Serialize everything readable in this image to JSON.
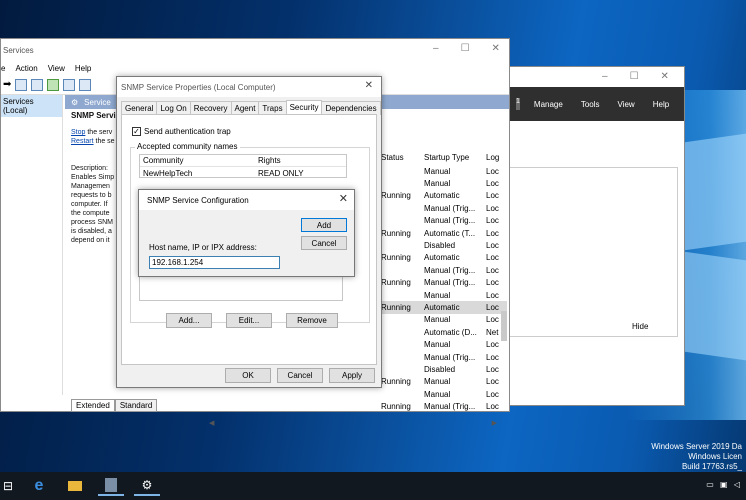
{
  "desktop": {
    "info_lines": [
      "Windows Server 2019 Da",
      "Windows Licen",
      "Build 17763.rs5_"
    ]
  },
  "services_window": {
    "title": "Services",
    "menu": [
      "e",
      "Action",
      "View",
      "Help"
    ],
    "tree_item": "Services (Local)",
    "list_header": "Service",
    "selected_service": "SNMP Servic",
    "stop_link": "Stop",
    "stop_rest": " the serv",
    "restart_link": "Restart",
    "restart_rest": " the se",
    "description_label": "Description:",
    "description_lines": [
      "Enables Simp",
      "Managemen",
      "requests to b",
      "computer. If",
      "the compute",
      "process SNM",
      "is disabled, a",
      "depend on it"
    ],
    "columns": {
      "status": "Status",
      "startup": "Startup Type",
      "log": "Log"
    },
    "rows": [
      {
        "status": "",
        "startup": "Manual",
        "log": "Loc"
      },
      {
        "status": "",
        "startup": "Manual",
        "log": "Loc"
      },
      {
        "status": "Running",
        "startup": "Automatic",
        "log": "Loc"
      },
      {
        "status": "",
        "startup": "Manual (Trig...",
        "log": "Loc"
      },
      {
        "status": "",
        "startup": "Manual (Trig...",
        "log": "Loc"
      },
      {
        "status": "Running",
        "startup": "Automatic (T...",
        "log": "Loc"
      },
      {
        "status": "",
        "startup": "Disabled",
        "log": "Loc"
      },
      {
        "status": "Running",
        "startup": "Automatic",
        "log": "Loc"
      },
      {
        "status": "",
        "startup": "Manual (Trig...",
        "log": "Loc"
      },
      {
        "status": "Running",
        "startup": "Manual (Trig...",
        "log": "Loc"
      },
      {
        "status": "",
        "startup": "Manual",
        "log": "Loc"
      },
      {
        "status": "Running",
        "startup": "Automatic",
        "log": "Loc"
      },
      {
        "status": "",
        "startup": "Manual",
        "log": "Loc"
      },
      {
        "status": "",
        "startup": "Automatic (D...",
        "log": "Net"
      },
      {
        "status": "",
        "startup": "Manual",
        "log": "Loc"
      },
      {
        "status": "",
        "startup": "Manual (Trig...",
        "log": "Loc"
      },
      {
        "status": "",
        "startup": "Disabled",
        "log": "Loc"
      },
      {
        "status": "Running",
        "startup": "Manual",
        "log": "Loc"
      },
      {
        "status": "",
        "startup": "Manual",
        "log": "Loc"
      },
      {
        "status": "Running",
        "startup": "Manual (Trig...",
        "log": "Loc"
      }
    ],
    "selected_row_index": 11,
    "tab_extended": "Extended",
    "tab_standard": "Standard"
  },
  "server_manager": {
    "notification_count": "1",
    "menu": [
      "Manage",
      "Tools",
      "View",
      "Help"
    ],
    "hide": "Hide"
  },
  "properties_dialog": {
    "title": "SNMP Service Properties (Local Computer)",
    "tabs": [
      "General",
      "Log On",
      "Recovery",
      "Agent",
      "Traps",
      "Security",
      "Dependencies"
    ],
    "active_tab": "Security",
    "send_auth_trap": "Send authentication trap",
    "send_auth_trap_checked": true,
    "group_label": "Accepted community names",
    "list_headers": {
      "community": "Community",
      "rights": "Rights"
    },
    "community_rows": [
      {
        "community": "NewHelpTech",
        "rights": "READ ONLY"
      }
    ],
    "add_button": "Add...",
    "edit_button": "Edit...",
    "remove_button": "Remove",
    "ok": "OK",
    "cancel": "Cancel",
    "apply": "Apply"
  },
  "config_dialog": {
    "title": "SNMP Service Configuration",
    "host_label": "Host name, IP or IPX address:",
    "host_value": "192.168.1.254",
    "add": "Add",
    "cancel": "Cancel"
  },
  "taskbar": {
    "icons": [
      "task-view-icon",
      "edge-icon",
      "file-explorer-icon",
      "server-manager-icon",
      "services-icon"
    ]
  }
}
